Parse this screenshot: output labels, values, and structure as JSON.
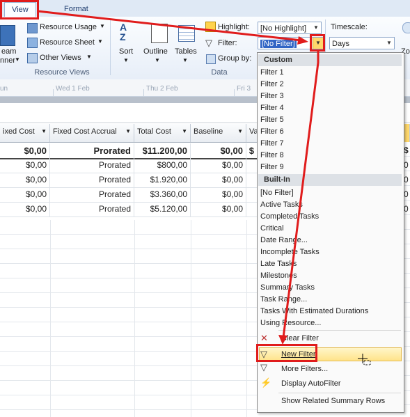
{
  "ribbon": {
    "tabs": [
      "View",
      "Format"
    ],
    "resource_views": {
      "items": [
        "Resource Usage",
        "Resource Sheet",
        "Other Views"
      ],
      "team_planner_top": "eam",
      "team_planner_bottom": "nner",
      "group_label": "Resource Views"
    },
    "data": {
      "sort_label": "Sort",
      "outline_label": "Outline",
      "tables_label": "Tables",
      "highlight_label": "Highlight:",
      "highlight_value": "[No Highlight]",
      "filter_label": "Filter:",
      "filter_value": "[No Filter]",
      "groupby_label": "Group by:",
      "group_label": "Data"
    },
    "timescale": {
      "label": "Timescale:",
      "value": "Days",
      "partial_zoom": "Zoo"
    }
  },
  "timeline": {
    "labels": [
      "un",
      "Wed 1 Feb",
      "Thu 2 Feb",
      "Fri 3"
    ]
  },
  "grid": {
    "headers": [
      "ixed Cost",
      "Fixed Cost Accrual",
      "Total Cost",
      "Baseline",
      "Va"
    ],
    "rows": [
      {
        "fixed_cost": "$0,00",
        "accrual": "Prorated",
        "total": "$11.200,00",
        "baseline": "$0,00",
        "va": "$",
        "summary": true
      },
      {
        "fixed_cost": "$0,00",
        "accrual": "Prorated",
        "total": "$800,00",
        "baseline": "$0,00",
        "va": "",
        "summary": false
      },
      {
        "fixed_cost": "$0,00",
        "accrual": "Prorated",
        "total": "$1.920,00",
        "baseline": "$0,00",
        "va": "",
        "summary": false
      },
      {
        "fixed_cost": "$0,00",
        "accrual": "Prorated",
        "total": "$3.360,00",
        "baseline": "$0,00",
        "va": "",
        "summary": false
      },
      {
        "fixed_cost": "$0,00",
        "accrual": "Prorated",
        "total": "$5.120,00",
        "baseline": "$0,00",
        "va": "",
        "summary": false
      }
    ],
    "right_partial": [
      "$",
      "0",
      "0",
      "0",
      "0"
    ]
  },
  "menu": {
    "custom_header": "Custom",
    "custom": [
      "Filter 1",
      "Filter 2",
      "Filter 3",
      "Filter 4",
      "Filter 5",
      "Filter 6",
      "Filter 7",
      "Filter 8",
      "Filter 9"
    ],
    "builtin_header": "Built-In",
    "builtin": [
      "[No Filter]",
      "Active Tasks",
      "Completed Tasks",
      "Critical",
      "Date Range...",
      "Incomplete Tasks",
      "Late Tasks",
      "Milestones",
      "Summary Tasks",
      "Task Range...",
      "Tasks With Estimated Durations",
      "Using Resource..."
    ],
    "actions": [
      "Clear Filter",
      "New Filter",
      "More Filters...",
      "Display AutoFilter",
      "Show Related Summary Rows"
    ],
    "icons": [
      "clear-filter-icon",
      "new-filter-icon",
      "more-filters-icon",
      "autofilter-icon"
    ]
  },
  "colors": {
    "annotation": "#e01c1c",
    "highlight": "#ffe38a",
    "ribbon": "#dfe9f5"
  }
}
